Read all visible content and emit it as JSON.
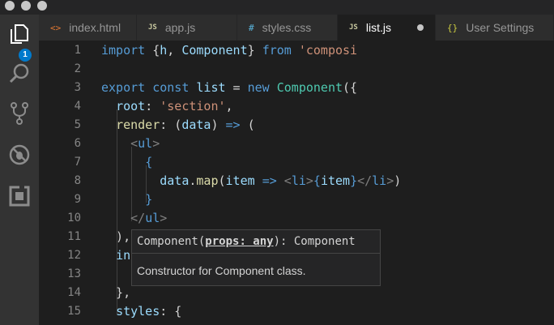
{
  "tabs": [
    {
      "icon": "<>",
      "name": "index.html",
      "active": false
    },
    {
      "icon": "JS",
      "name": "app.js",
      "active": false
    },
    {
      "icon": "#",
      "name": "styles.css",
      "active": false
    },
    {
      "icon": "JS",
      "name": "list.js",
      "active": true,
      "dirty": true
    },
    {
      "icon": "{}",
      "name": "User Settings",
      "active": false
    }
  ],
  "activity": {
    "explorer_badge": "1"
  },
  "editor": {
    "line_numbers": [
      "1",
      "2",
      "3",
      "4",
      "5",
      "6",
      "7",
      "8",
      "9",
      "10",
      "11",
      "12",
      "13",
      "14",
      "15"
    ],
    "lines": [
      {
        "tokens": [
          [
            "kw",
            "import"
          ],
          [
            "pl",
            " {"
          ],
          [
            "var",
            "h"
          ],
          [
            "pl",
            ", "
          ],
          [
            "var",
            "Component"
          ],
          [
            "pl",
            "} "
          ],
          [
            "kw",
            "from"
          ],
          [
            "pl",
            " "
          ],
          [
            "str",
            "'composi"
          ]
        ]
      },
      {
        "tokens": []
      },
      {
        "tokens": [
          [
            "kw",
            "export"
          ],
          [
            "pl",
            " "
          ],
          [
            "kw",
            "const"
          ],
          [
            "pl",
            " "
          ],
          [
            "var",
            "list"
          ],
          [
            "pl",
            " = "
          ],
          [
            "kw",
            "new"
          ],
          [
            "pl",
            " "
          ],
          [
            "cls",
            "Component"
          ],
          [
            "pl",
            "({"
          ]
        ]
      },
      {
        "tokens": [
          [
            "pl",
            "  "
          ],
          [
            "var",
            "root"
          ],
          [
            "pl",
            ": "
          ],
          [
            "str",
            "'section'"
          ],
          [
            "pl",
            ","
          ]
        ]
      },
      {
        "tokens": [
          [
            "pl",
            "  "
          ],
          [
            "fn",
            "render"
          ],
          [
            "pl",
            ": ("
          ],
          [
            "var",
            "data"
          ],
          [
            "pl",
            ") "
          ],
          [
            "kw",
            "=>"
          ],
          [
            "pl",
            " ("
          ]
        ]
      },
      {
        "tokens": [
          [
            "pl",
            "    "
          ],
          [
            "brk",
            "<"
          ],
          [
            "tag",
            "ul"
          ],
          [
            "brk",
            ">"
          ]
        ]
      },
      {
        "tokens": [
          [
            "pl",
            "      "
          ],
          [
            "kw",
            "{"
          ]
        ]
      },
      {
        "tokens": [
          [
            "pl",
            "        "
          ],
          [
            "var",
            "data"
          ],
          [
            "pl",
            "."
          ],
          [
            "fn",
            "map"
          ],
          [
            "pl",
            "("
          ],
          [
            "var",
            "item"
          ],
          [
            "pl",
            " "
          ],
          [
            "kw",
            "=>"
          ],
          [
            "pl",
            " "
          ],
          [
            "brk",
            "<"
          ],
          [
            "tag",
            "li"
          ],
          [
            "brk",
            ">"
          ],
          [
            "kw",
            "{"
          ],
          [
            "var",
            "item"
          ],
          [
            "kw",
            "}"
          ],
          [
            "brk",
            "</"
          ],
          [
            "tag",
            "li"
          ],
          [
            "brk",
            ">"
          ],
          [
            "pl",
            ")"
          ]
        ]
      },
      {
        "tokens": [
          [
            "pl",
            "      "
          ],
          [
            "kw",
            "}"
          ]
        ]
      },
      {
        "tokens": [
          [
            "pl",
            "    "
          ],
          [
            "brk",
            "</"
          ],
          [
            "tag",
            "ul"
          ],
          [
            "brk",
            ">"
          ]
        ]
      },
      {
        "tokens": [
          [
            "pl",
            "  ),"
          ]
        ]
      },
      {
        "tokens": [
          [
            "pl",
            "  "
          ],
          [
            "var",
            "in"
          ]
        ]
      },
      {
        "tokens": []
      },
      {
        "tokens": [
          [
            "pl",
            "  },"
          ]
        ]
      },
      {
        "tokens": [
          [
            "pl",
            "  "
          ],
          [
            "var",
            "styles"
          ],
          [
            "pl",
            ": {"
          ]
        ]
      }
    ]
  },
  "hover": {
    "name": "Component",
    "open": "(",
    "arg": "props: any",
    "close": "): Component",
    "doc": "Constructor for Component class."
  }
}
